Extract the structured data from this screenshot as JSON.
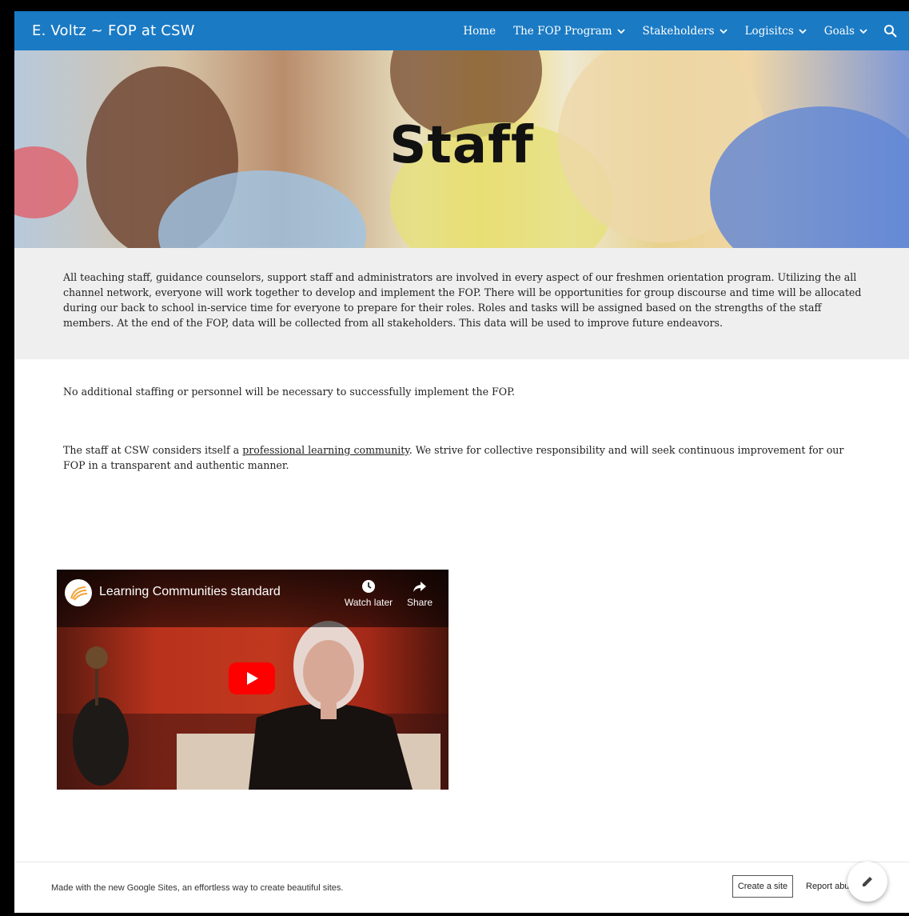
{
  "header": {
    "site_title": "E. Voltz ~ FOP at CSW",
    "nav": [
      {
        "label": "Home",
        "has_dropdown": false
      },
      {
        "label": "The FOP Program",
        "has_dropdown": true
      },
      {
        "label": "Stakeholders",
        "has_dropdown": true
      },
      {
        "label": "Logisitcs",
        "has_dropdown": true
      },
      {
        "label": "Goals",
        "has_dropdown": true
      }
    ],
    "search_icon": "search-icon",
    "bar_color": "#1a7ac4"
  },
  "hero": {
    "title": "Staff"
  },
  "content": {
    "intro": "All teaching staff, guidance counselors, support staff and administrators are involved in every aspect of our freshmen orientation program. Utilizing the all channel network, everyone will work together to develop and implement the FOP. There will be opportunities for group discourse and time will be allocated during our back to school in-service time for everyone to prepare for their roles. Roles and tasks will be assigned based on the strengths of the staff members. At the end of the FOP, data will be collected from all stakeholders. This data will be used to improve future endeavors.",
    "staffing": "No additional staffing or personnel will be necessary to successfully implement the FOP.",
    "plc_before": "The staff at CSW considers itself a ",
    "plc_link": "professional learning community",
    "plc_after": ". We strive for collective responsibility and will seek continuous improvement for our FOP in a transparent and authentic manner."
  },
  "video": {
    "title": "Learning Communities standard",
    "watch_later": "Watch later",
    "share": "Share"
  },
  "footer": {
    "text": "Made with the new Google Sites, an effortless way to create beautiful sites.",
    "create_site": "Create a site",
    "report_abuse": "Report abu"
  }
}
